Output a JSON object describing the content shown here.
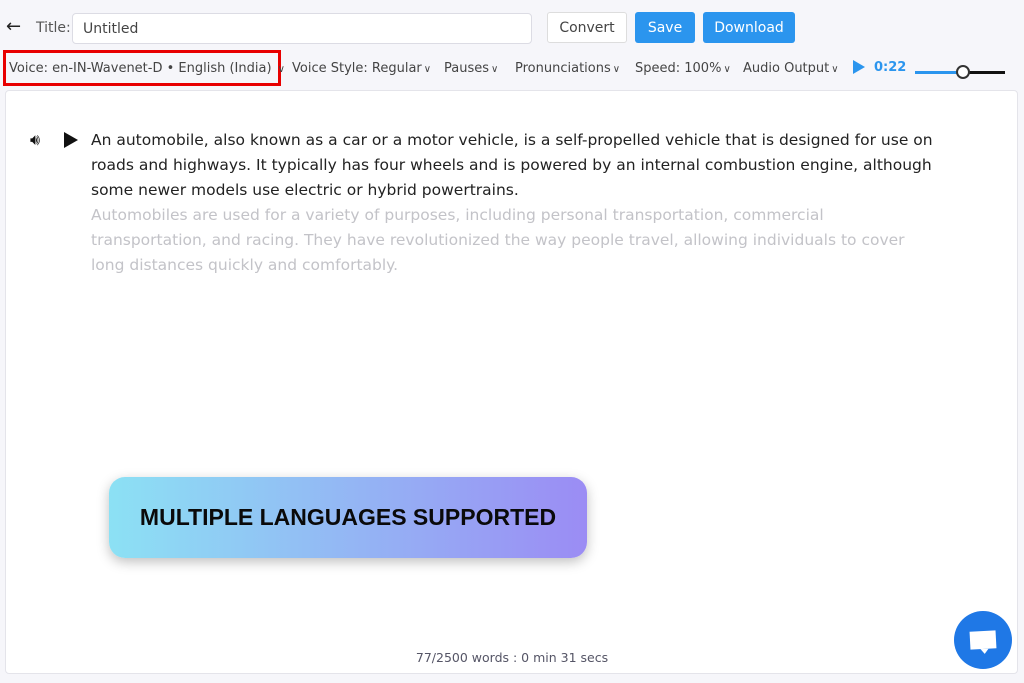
{
  "header": {
    "back_icon": "arrow-left-icon",
    "title_label": "Title:",
    "title_value": "Untitled",
    "convert": "Convert",
    "save": "Save",
    "download": "Download"
  },
  "toolbar": {
    "voice": "Voice: en-IN-Wavenet-D • English (India)",
    "voice_style": "Voice Style: Regular",
    "pauses": "Pauses",
    "pronunciations": "Pronunciations",
    "speed": "Speed: 100%",
    "audio_output": "Audio Output",
    "time": "0:22",
    "progress": 0.53,
    "chevron": "⌄"
  },
  "editor": {
    "paragraph1": "An automobile, also known as a car or a motor vehicle, is a self-propelled vehicle that is designed for use on roads and highways. It typically has four wheels and is powered by an internal combustion engine, although some newer models use electric or hybrid powertrains.",
    "paragraph2": "Automobiles are used for a variety of purposes, including personal transportation, commercial transportation, and racing. They have revolutionized the way people travel, allowing individuals to cover long distances quickly and comfortably."
  },
  "banner": "MULTIPLE LANGUAGES SUPPORTED",
  "footer": {
    "word_count": "77/2500 words : 0 min 31 secs"
  },
  "colors": {
    "accent": "#2b95ee",
    "highlight": "#e80000",
    "chat": "#1f78e6"
  }
}
